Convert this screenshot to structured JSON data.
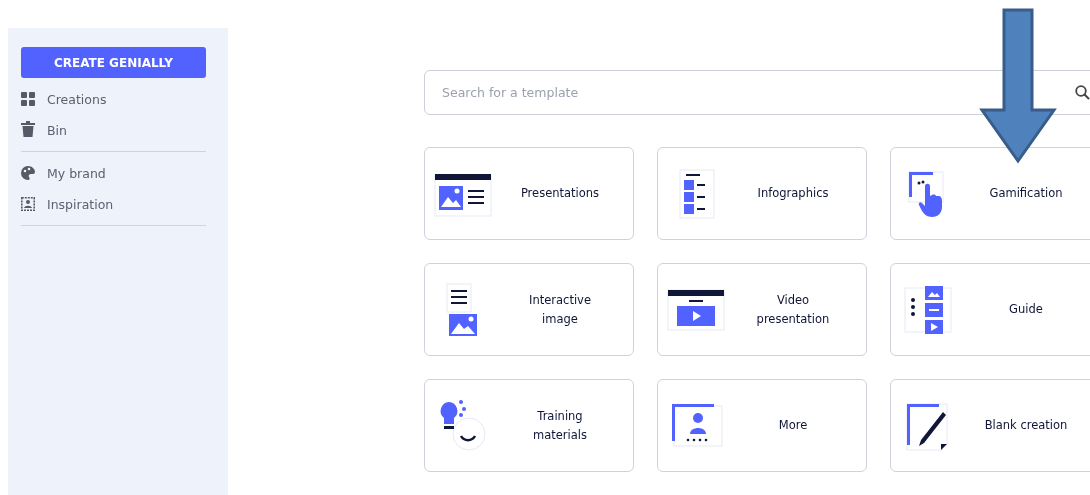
{
  "sidebar": {
    "create_button": "CREATE GENIALLY",
    "groups": [
      [
        {
          "kind": "creations",
          "label": "Creations"
        },
        {
          "kind": "bin",
          "label": "Bin"
        }
      ],
      [
        {
          "kind": "brand",
          "label": "My brand"
        },
        {
          "kind": "inspiration",
          "label": "Inspiration"
        }
      ]
    ]
  },
  "search": {
    "placeholder": "Search for a template"
  },
  "templates": [
    {
      "kind": "presentation",
      "label": "Presentations"
    },
    {
      "kind": "infographic",
      "label": "Infographics"
    },
    {
      "kind": "gamification",
      "label": "Gamification"
    },
    {
      "kind": "interactive-image",
      "label": "Interactive image"
    },
    {
      "kind": "video",
      "label": "Video presentation"
    },
    {
      "kind": "guide",
      "label": "Guide"
    },
    {
      "kind": "training",
      "label": "Training materials"
    },
    {
      "kind": "more",
      "label": "More"
    },
    {
      "kind": "blank",
      "label": "Blank creation"
    }
  ]
}
